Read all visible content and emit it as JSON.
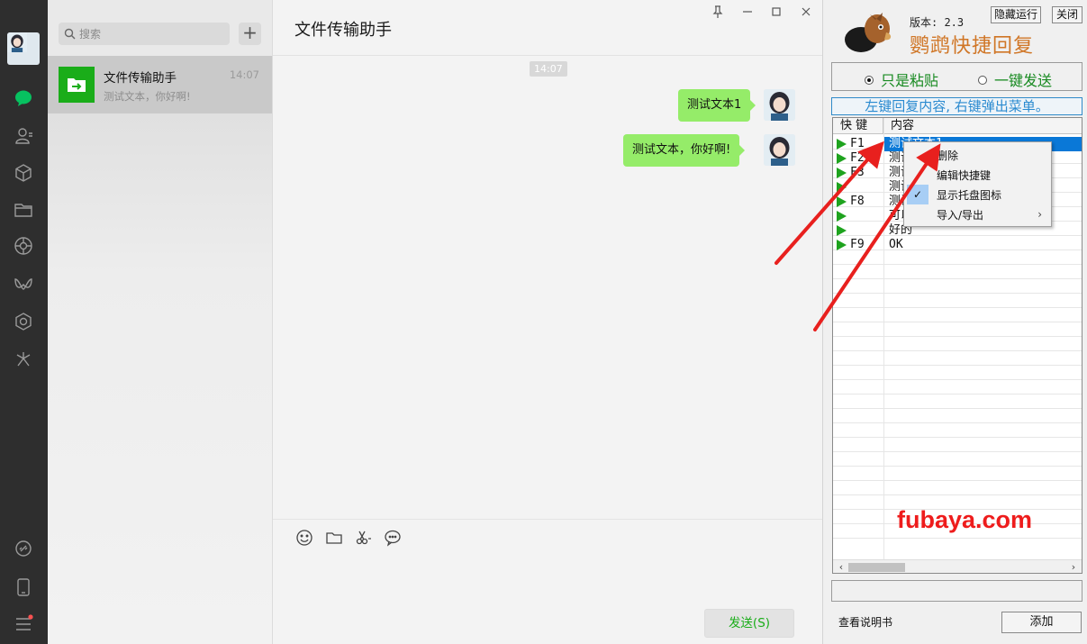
{
  "sidebar": {
    "icons": [
      "chat-icon",
      "contacts-icon",
      "favorites-icon",
      "files-icon",
      "moments-icon",
      "channels-icon",
      "search-ai-icon",
      "mini-programs-icon",
      "link-icon",
      "phone-icon",
      "menu-icon"
    ],
    "active_color": "#07c160"
  },
  "chat_list": {
    "search_placeholder": "搜索",
    "add_label": "+",
    "items": [
      {
        "name": "文件传输助手",
        "time": "14:07",
        "preview": "测试文本，你好啊!"
      }
    ]
  },
  "chat": {
    "title": "文件传输助手",
    "time_divider": "14:07",
    "messages": [
      {
        "text": "测试文本1"
      },
      {
        "text": "测试文本，你好啊!"
      }
    ],
    "send_label": "发送(S)"
  },
  "quick_reply": {
    "version": "版本: 2.3",
    "app_name": "鹦鹉快捷回复",
    "hide_label": "隐藏运行",
    "close_label": "关闭",
    "mode_paste": "只是粘贴",
    "mode_send": "一键发送",
    "hint": "左键回复内容, 右键弹出菜单。",
    "col_key": "快 键",
    "col_content": "内容",
    "rows": [
      {
        "key": "F1",
        "content": "测试文本1",
        "selected": true
      },
      {
        "key": "F2",
        "content": "测试"
      },
      {
        "key": "F3",
        "content": "测试"
      },
      {
        "key": "",
        "content": "测试"
      },
      {
        "key": "F8",
        "content": "测试"
      },
      {
        "key": "",
        "content": "可以"
      },
      {
        "key": "",
        "content": "好的"
      },
      {
        "key": "F9",
        "content": "OK"
      }
    ],
    "manual_label": "查看说明书",
    "add_label": "添加",
    "watermark": "fubaya.com"
  },
  "context_menu": {
    "items": [
      "删除",
      "编辑快捷键",
      "显示托盘图标",
      "导入/导出"
    ],
    "checked_mark": "✓",
    "submenu_mark": "›"
  },
  "window_controls": [
    "pin-icon",
    "minimize-icon",
    "maximize-icon",
    "close-icon"
  ]
}
